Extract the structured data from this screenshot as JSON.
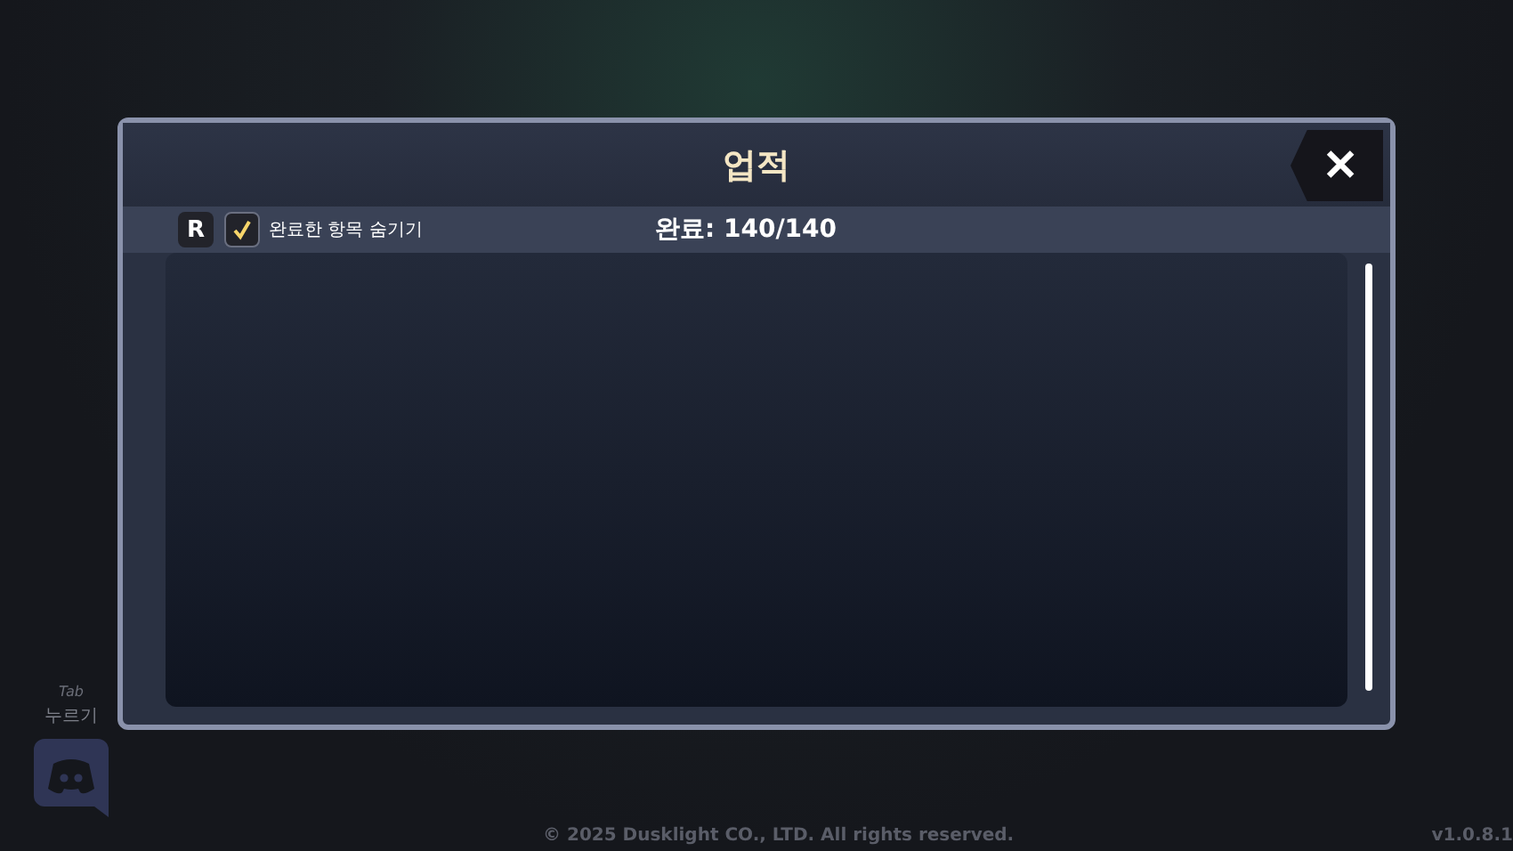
{
  "dialog": {
    "title": "업적",
    "close_label": "✕"
  },
  "toolbar": {
    "reset_key": "R",
    "hide_completed": {
      "label": "완료한 항목 숨기기",
      "checked": true
    },
    "progress": "완료: 140/140"
  },
  "hint": {
    "key": "Tab",
    "action": "누르기"
  },
  "footer": {
    "copyright": "© 2025 Dusklight CO., LTD. All rights reserved.",
    "version": "v1.0.8.1"
  }
}
